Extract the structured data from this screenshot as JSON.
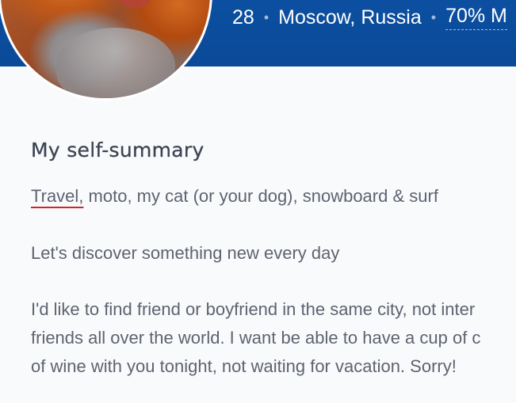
{
  "header": {
    "age": "28",
    "separator": "•",
    "location": "Moscow, Russia",
    "match": "70% M"
  },
  "self_summary": {
    "title": "My self-summary",
    "line1_flagged_word": "Travel,",
    "line1_rest": " moto, my cat (or your dog), snowboard & surf",
    "line2": "Let's discover something new every day",
    "line3": [
      "I'd like to find friend or boyfriend in the same city, not inter",
      "friends all over the world. I want be able to have a cup of c",
      "of wine with you tonight, not waiting for vacation. Sorry!"
    ]
  },
  "colors": {
    "header_blue": "#0c4fa0",
    "spellcheck_underline": "#d0262b",
    "text_gray": "#5e6370",
    "title_dark": "#3d4452"
  }
}
